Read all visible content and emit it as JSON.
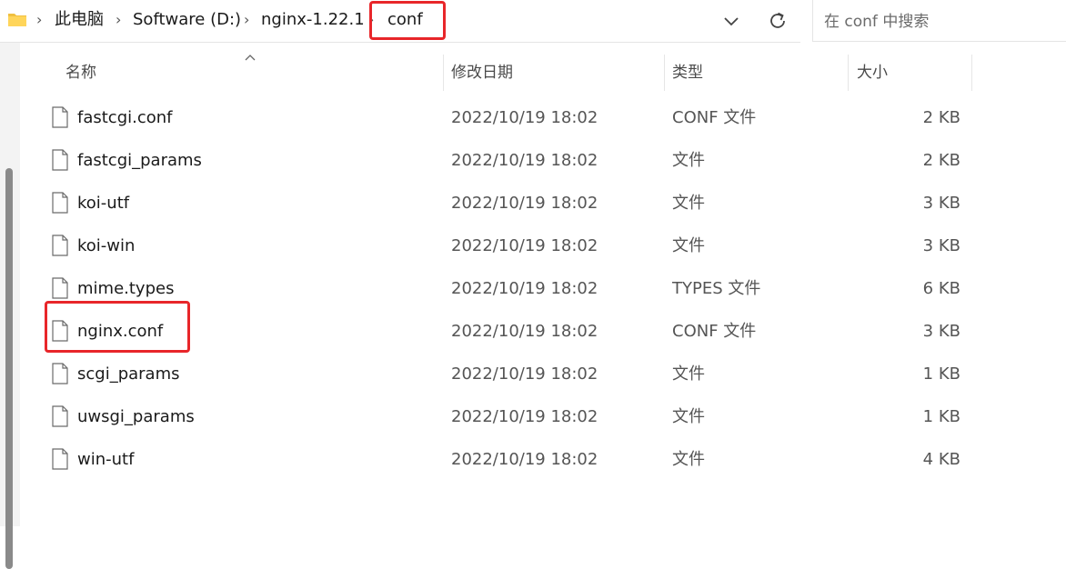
{
  "address_bar": {
    "crumbs": [
      "此电脑",
      "Software (D:)",
      "nginx-1.22.1",
      "conf"
    ],
    "highlight_color": "#e8262a"
  },
  "search": {
    "placeholder": "在 conf 中搜索",
    "value": ""
  },
  "columns": {
    "name": "名称",
    "date": "修改日期",
    "type": "类型",
    "size": "大小"
  },
  "files": [
    {
      "name": "fastcgi.conf",
      "date": "2022/10/19 18:02",
      "type": "CONF 文件",
      "size": "2 KB"
    },
    {
      "name": "fastcgi_params",
      "date": "2022/10/19 18:02",
      "type": "文件",
      "size": "2 KB"
    },
    {
      "name": "koi-utf",
      "date": "2022/10/19 18:02",
      "type": "文件",
      "size": "3 KB"
    },
    {
      "name": "koi-win",
      "date": "2022/10/19 18:02",
      "type": "文件",
      "size": "3 KB"
    },
    {
      "name": "mime.types",
      "date": "2022/10/19 18:02",
      "type": "TYPES 文件",
      "size": "6 KB"
    },
    {
      "name": "nginx.conf",
      "date": "2022/10/19 18:02",
      "type": "CONF 文件",
      "size": "3 KB",
      "highlighted": true
    },
    {
      "name": "scgi_params",
      "date": "2022/10/19 18:02",
      "type": "文件",
      "size": "1 KB"
    },
    {
      "name": "uwsgi_params",
      "date": "2022/10/19 18:02",
      "type": "文件",
      "size": "1 KB"
    },
    {
      "name": "win-utf",
      "date": "2022/10/19 18:02",
      "type": "文件",
      "size": "4 KB"
    }
  ],
  "icons": {
    "folder": "folder-icon",
    "chevron": "chevron-right-icon",
    "dropdown": "chevron-down-icon",
    "refresh": "refresh-icon",
    "sort": "sort-ascending-icon",
    "file": "file-icon"
  }
}
